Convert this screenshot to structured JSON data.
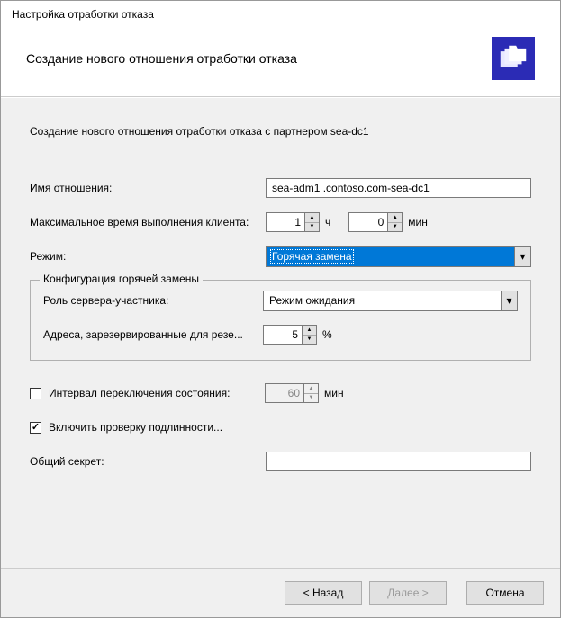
{
  "window": {
    "title": "Настройка отработки отказа"
  },
  "header": {
    "subtitle": "Создание нового отношения отработки отказа"
  },
  "intro": "Создание нового отношения отработки отказа с партнером sea-dc1",
  "form": {
    "relation_name_label": "Имя отношения:",
    "relation_name_value": "sea-adm1 .contoso.com-sea-dc1",
    "max_client_time_label": "Максимальное время выполнения клиента:",
    "hours_value": "1",
    "hours_unit": "ч",
    "minutes_value": "0",
    "minutes_unit": "мин",
    "mode_label": "Режим:",
    "mode_value": "Горячая замена"
  },
  "hot_standby": {
    "legend": "Конфигурация горячей замены",
    "role_label": "Роль сервера-участника:",
    "role_value": "Режим ожидания",
    "reserved_label": "Адреса, зарезервированные для резе...",
    "reserved_value": "5",
    "reserved_unit": "%"
  },
  "options": {
    "interval_label": "Интервал переключения состояния:",
    "interval_value": "60",
    "interval_unit": "мин",
    "auth_label": "Включить проверку подлинности...",
    "secret_label": "Общий секрет:",
    "secret_value": ""
  },
  "buttons": {
    "back": "< Назад",
    "next": "Далее >",
    "cancel": "Отмена"
  }
}
